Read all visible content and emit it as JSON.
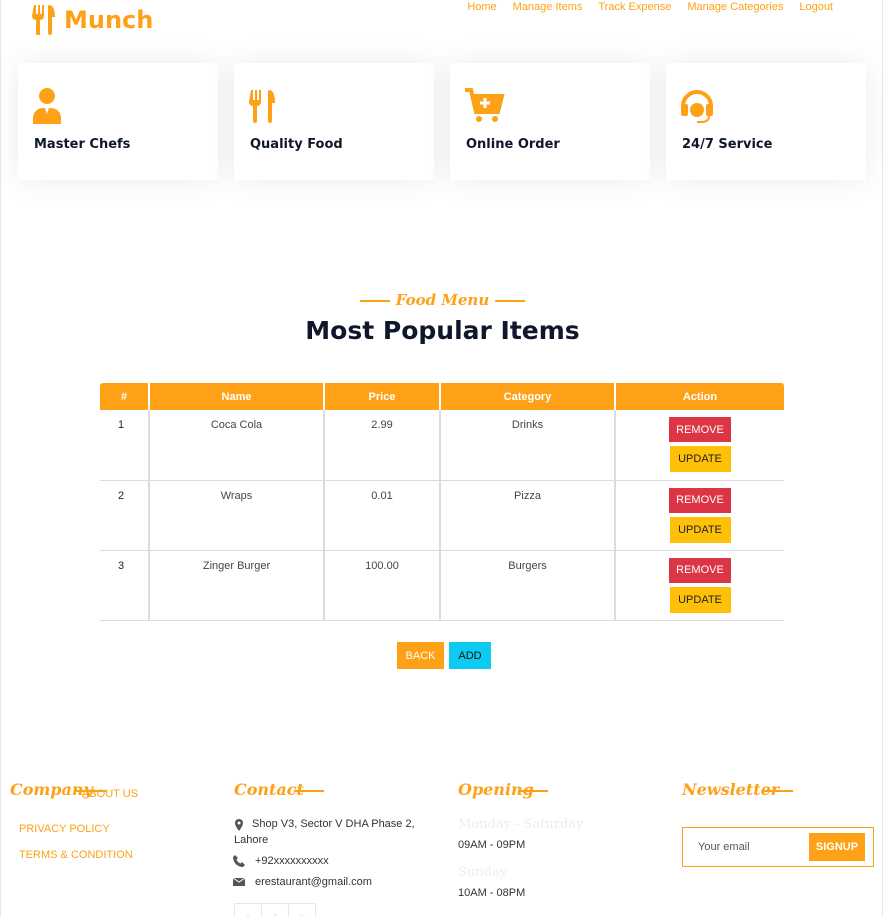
{
  "brand": {
    "name": "Munch",
    "icon": "utensils-icon",
    "color": "#fea116"
  },
  "nav": [
    "Home",
    "Manage Items",
    "Track Expense",
    "Manage Categories",
    "Logout"
  ],
  "services": [
    {
      "label": "Master Chefs",
      "icon": "chef-user-icon"
    },
    {
      "label": "Quality Food",
      "icon": "utensils-icon"
    },
    {
      "label": "Online Order",
      "icon": "cart-plus-icon"
    },
    {
      "label": "24/7 Service",
      "icon": "headset-icon"
    }
  ],
  "section": {
    "subtitle": "Food Menu",
    "title": "Most Popular Items"
  },
  "table": {
    "headers": [
      "#",
      "Name",
      "Price",
      "Category",
      "Action"
    ],
    "rows": [
      {
        "num": "1",
        "name": "Coca Cola",
        "price": "2.99",
        "category": "Drinks"
      },
      {
        "num": "2",
        "name": "Wraps",
        "price": "0.01",
        "category": "Pizza"
      },
      {
        "num": "3",
        "name": "Zinger Burger",
        "price": "100.00",
        "category": "Burgers"
      }
    ],
    "remove_label": "REMOVE",
    "update_label": "UPDATE"
  },
  "actions": {
    "back_label": "BACK",
    "add_label": "ADD"
  },
  "footer": {
    "company": {
      "heading": "Company",
      "links": [
        "ABOUT US",
        "PRIVACY POLICY",
        "TERMS & CONDITION"
      ]
    },
    "contact": {
      "heading": "Contact",
      "address": "Shop V3, Sector V DHA Phase 2, Lahore",
      "phone": "+92xxxxxxxxxx",
      "email": "erestaurant@gmail.com"
    },
    "opening": {
      "heading": "Opening",
      "day1": "Monday - Saturday",
      "time1": "09AM - 09PM",
      "day2": "Sunday",
      "time2": "10AM - 08PM"
    },
    "newsletter": {
      "heading": "Newsletter",
      "placeholder": "Your email",
      "button": "SIGNUP"
    }
  },
  "colors": {
    "primary": "#fea116",
    "danger": "#dc3545",
    "warning": "#ffc107",
    "info": "#0dcaf0",
    "dark": "#0f172b"
  }
}
